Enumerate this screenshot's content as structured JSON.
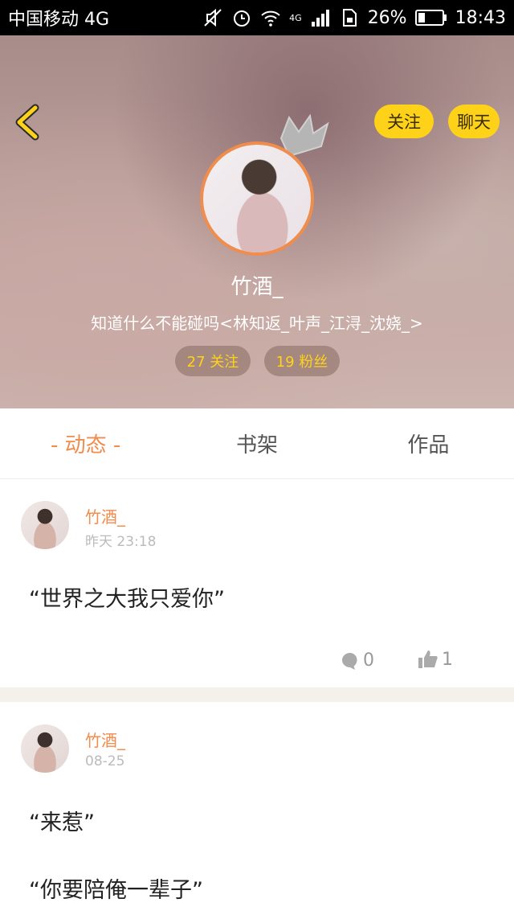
{
  "status_bar": {
    "carrier": "中国移动 4G",
    "network": "4G",
    "battery": "26%",
    "time": "18:43"
  },
  "header": {
    "follow_label": "关注",
    "chat_label": "聊天",
    "username": "竹酒_",
    "bio": "知道什么不能碰吗<林知返_叶声_江浔_沈娆_>",
    "following": "27 关注",
    "fans": "19 粉丝",
    "accent_color": "#ffd21a",
    "avatar_border_color": "#f08c4c"
  },
  "tabs": [
    {
      "label": "- 动态 -",
      "active": true
    },
    {
      "label": "书架",
      "active": false
    },
    {
      "label": "作品",
      "active": false
    }
  ],
  "posts": [
    {
      "author": "竹酒_",
      "time": "昨天 23:18",
      "lines": [
        "“世界之大我只爱你”"
      ],
      "comments": "0",
      "likes": "1"
    },
    {
      "author": "竹酒_",
      "time": "08-25",
      "lines": [
        "“来惹”",
        "“你要陪俺一辈子”"
      ]
    }
  ]
}
